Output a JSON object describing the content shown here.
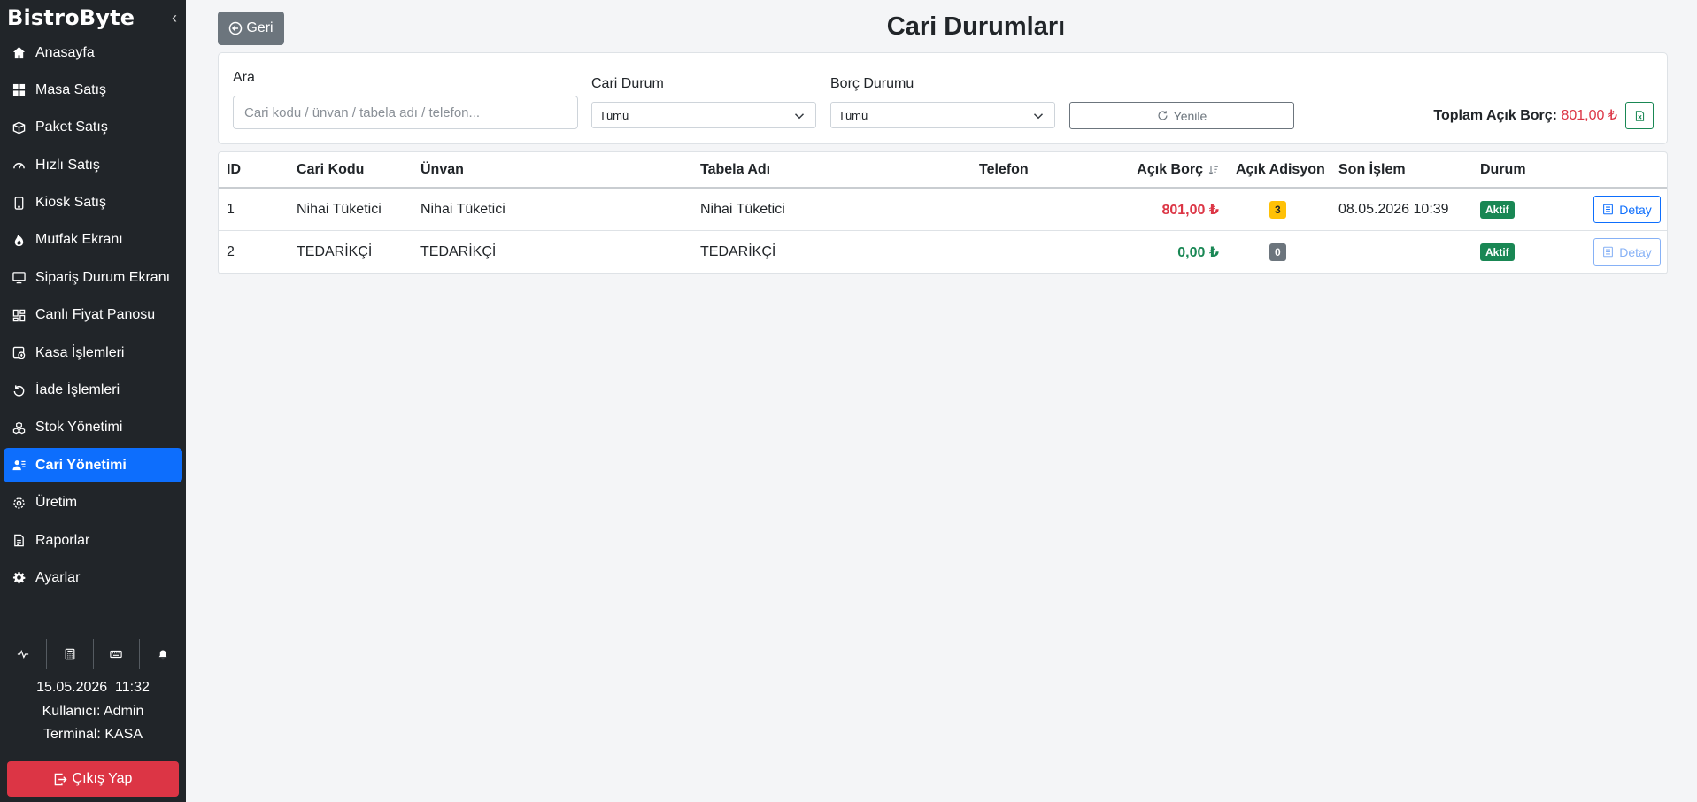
{
  "app": {
    "brand": "BistroByte"
  },
  "sidebar": {
    "items": [
      {
        "label": "Anasayfa",
        "icon": "home-icon",
        "active": false
      },
      {
        "label": "Masa Satış",
        "icon": "grid-icon",
        "active": false
      },
      {
        "label": "Paket Satış",
        "icon": "box-icon",
        "active": false
      },
      {
        "label": "Hızlı Satış",
        "icon": "speedometer-icon",
        "active": false
      },
      {
        "label": "Kiosk Satış",
        "icon": "tablet-icon",
        "active": false
      },
      {
        "label": "Mutfak Ekranı",
        "icon": "fire-icon",
        "active": false
      },
      {
        "label": "Sipariş Durum Ekranı",
        "icon": "monitor-icon",
        "active": false
      },
      {
        "label": "Canlı Fiyat Panosu",
        "icon": "dashboard-icon",
        "active": false
      },
      {
        "label": "Kasa İşlemleri",
        "icon": "cash-register-icon",
        "active": false
      },
      {
        "label": "İade İşlemleri",
        "icon": "undo-icon",
        "active": false
      },
      {
        "label": "Stok Yönetimi",
        "icon": "boxes-icon",
        "active": false
      },
      {
        "label": "Cari Yönetimi",
        "icon": "person-lines-icon",
        "active": true
      },
      {
        "label": "Üretim",
        "icon": "gear-icon",
        "active": false
      },
      {
        "label": "Raporlar",
        "icon": "file-icon",
        "active": false
      },
      {
        "label": "Ayarlar",
        "icon": "settings-icon",
        "active": false
      }
    ],
    "tools": [
      "activity-icon",
      "calculator-icon",
      "keyboard-icon",
      "bell-icon"
    ],
    "info": {
      "datetime": "15.05.2026  11:32",
      "user": "Kullanıcı: Admin",
      "terminal": "Terminal: KASA"
    },
    "logout_label": "Çıkış Yap"
  },
  "header": {
    "back_label": "Geri",
    "title": "Cari Durumları"
  },
  "filters": {
    "search_label": "Ara",
    "search_placeholder": "Cari kodu / ünvan / tabela adı / telefon...",
    "search_value": "",
    "cari_durum_label": "Cari Durum",
    "cari_durum_value": "Tümü",
    "borc_durumu_label": "Borç Durumu",
    "borc_durumu_value": "Tümü",
    "refresh_label": "Yenile",
    "total_label": "Toplam Açık Borç:",
    "total_value": "801,00 ₺"
  },
  "table": {
    "columns": [
      "ID",
      "Cari Kodu",
      "Ünvan",
      "Tabela Adı",
      "Telefon",
      "Açık Borç",
      "Açık Adisyon",
      "Son İşlem",
      "Durum"
    ],
    "detail_label": "Detay",
    "rows": [
      {
        "id": "1",
        "cari_kodu": "Nihai Tüketici",
        "unvan": "Nihai Tüketici",
        "tabela": "Nihai Tüketici",
        "telefon": "",
        "acik_borc": "801,00 ₺",
        "acik_adisyon": "3",
        "son_islem": "08.05.2026 10:39",
        "durum": "Aktif"
      },
      {
        "id": "2",
        "cari_kodu": "TEDARİKÇİ",
        "unvan": "TEDARİKÇİ",
        "tabela": "TEDARİKÇİ",
        "telefon": "",
        "acik_borc": "0,00 ₺",
        "acik_adisyon": "0",
        "son_islem": "",
        "durum": "Aktif"
      }
    ]
  },
  "colors": {
    "sidebar_bg": "#212529",
    "active": "#0d6efd",
    "danger": "#dc3545",
    "success": "#198754",
    "warning": "#ffc107",
    "secondary": "#6c757d"
  }
}
